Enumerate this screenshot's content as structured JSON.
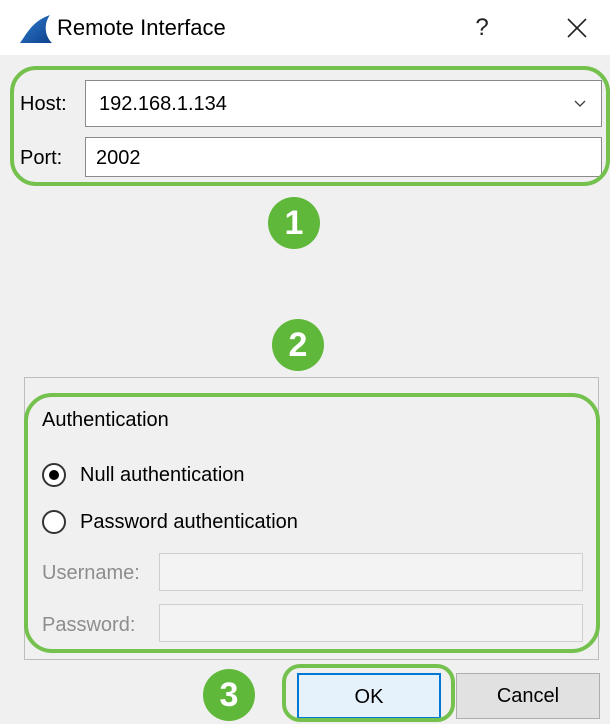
{
  "window": {
    "title": "Remote Interface",
    "help_label": "?"
  },
  "connection": {
    "host_label": "Host:",
    "host_value": "192.168.1.134",
    "port_label": "Port:",
    "port_value": "2002"
  },
  "annotations": {
    "step1": "1",
    "step2": "2",
    "step3": "3",
    "highlight_color": "#74c14d",
    "badge_color": "#5fb83a"
  },
  "authentication": {
    "title": "Authentication",
    "options": [
      {
        "label": "Null authentication",
        "selected": true
      },
      {
        "label": "Password authentication",
        "selected": false
      }
    ],
    "username_label": "Username:",
    "username_value": "",
    "password_label": "Password:",
    "password_value": ""
  },
  "buttons": {
    "ok": "OK",
    "cancel": "Cancel",
    "default_border_color": "#0078d7"
  },
  "icons": {
    "app": "shark-fin-icon",
    "dropdown": "chevron-down-icon",
    "close": "close-icon"
  }
}
